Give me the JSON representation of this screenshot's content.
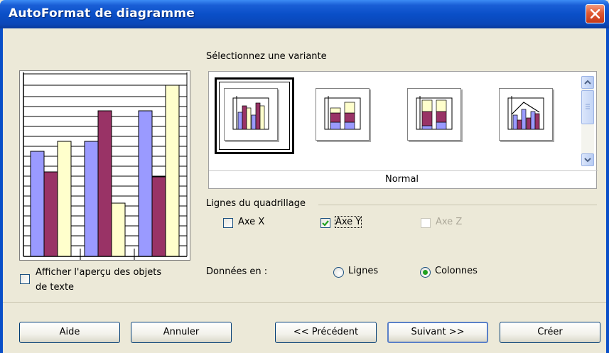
{
  "window": {
    "title": "AutoFormat de diagramme",
    "close_icon": "close-icon"
  },
  "variants": {
    "heading": "Sélectionnez une variante",
    "selected_label": "Normal",
    "thumbnails": [
      "normal-bar",
      "stacked-bar",
      "percent-stacked-bar",
      "bar-and-line"
    ]
  },
  "gridlines": {
    "heading": "Lignes du quadrillage",
    "axis_x": {
      "label": "Axe X",
      "checked": false,
      "enabled": true
    },
    "axis_y": {
      "label": "Axe Y",
      "checked": true,
      "enabled": true
    },
    "axis_z": {
      "label": "Axe Z",
      "checked": false,
      "enabled": false
    }
  },
  "data_series": {
    "label": "Données en :",
    "options": [
      {
        "label": "Lignes",
        "selected": false
      },
      {
        "label": "Colonnes",
        "selected": true
      }
    ]
  },
  "preview": {
    "show_text_objects_label_line1": "Afficher l'aperçu des objets",
    "show_text_objects_label_line2": "de texte",
    "show_text_objects_checked": false
  },
  "buttons": {
    "help": "Aide",
    "cancel": "Annuler",
    "previous": "<< Précédent",
    "next": "Suivant >>",
    "create": "Créer"
  },
  "colors": {
    "series1": "#9a9aff",
    "series2": "#993366",
    "series3": "#ffffcc",
    "titlebar": "#0a4fc8"
  }
}
